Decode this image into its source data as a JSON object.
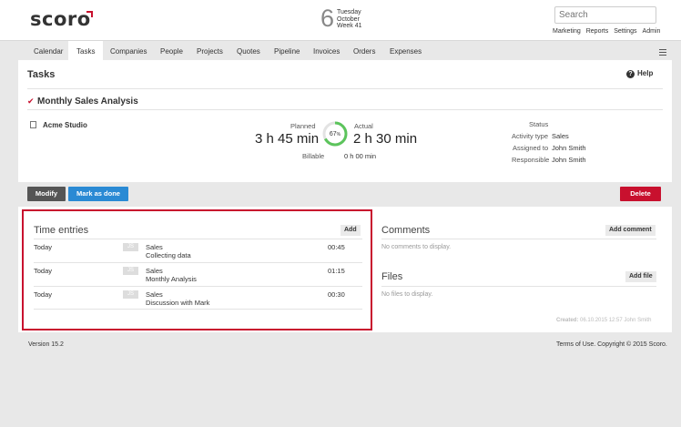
{
  "brand": {
    "logo": "scoro",
    "accent": "#c8102e"
  },
  "date": {
    "day": "6",
    "weekday": "Tuesday",
    "month": "October",
    "week": "Week 41"
  },
  "search": {
    "placeholder": "Search"
  },
  "toplinks": [
    "Marketing",
    "Reports",
    "Settings",
    "Admin"
  ],
  "nav": [
    "Calendar",
    "Tasks",
    "Companies",
    "People",
    "Projects",
    "Quotes",
    "Pipeline",
    "Invoices",
    "Orders",
    "Expenses"
  ],
  "page": {
    "title": "Tasks",
    "help": "Help"
  },
  "task": {
    "title": "Monthly Sales Analysis",
    "company": "Acme Studio",
    "planned_label": "Planned",
    "planned_value": "3 h 45 min",
    "actual_label": "Actual",
    "actual_value": "2 h 30 min",
    "progress": "67",
    "progress_unit": "%",
    "progress_fraction": 0.67,
    "billable_label": "Billable",
    "billable_value": "0 h 00 min",
    "status_label": "Status",
    "activity_type_label": "Activity type",
    "activity_type_value": "Sales",
    "assigned_label": "Assigned to",
    "assigned_value": "John Smith",
    "responsible_label": "Responsible",
    "responsible_value": "John Smith"
  },
  "actions": {
    "modify": "Modify",
    "mark_done": "Mark as done",
    "delete": "Delete"
  },
  "time_entries": {
    "title": "Time entries",
    "add": "Add",
    "rows": [
      {
        "date": "Today",
        "initials": "JS",
        "activity": "Sales",
        "description": "Collecting data",
        "duration": "00:45"
      },
      {
        "date": "Today",
        "initials": "JS",
        "activity": "Sales",
        "description": "Monthly Analysis",
        "duration": "01:15"
      },
      {
        "date": "Today",
        "initials": "JS",
        "activity": "Sales",
        "description": "Discussion with Mark",
        "duration": "00:30"
      }
    ]
  },
  "comments": {
    "title": "Comments",
    "add": "Add comment",
    "empty": "No comments to display."
  },
  "files": {
    "title": "Files",
    "add": "Add file",
    "empty": "No files to display."
  },
  "created": {
    "label": "Created:",
    "value": "06.10.2015 12:57 John Smith"
  },
  "footer": {
    "version": "Version 15.2",
    "links": "Terms of Use. Copyright © 2015 Scoro."
  }
}
